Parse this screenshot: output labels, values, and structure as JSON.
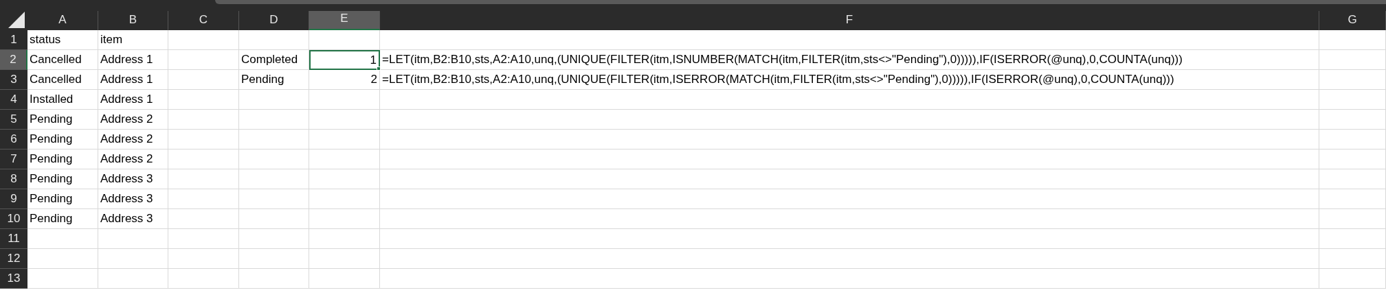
{
  "columns": [
    {
      "label": "A",
      "selected": false
    },
    {
      "label": "B",
      "selected": false
    },
    {
      "label": "C",
      "selected": false
    },
    {
      "label": "D",
      "selected": false
    },
    {
      "label": "E",
      "selected": true
    },
    {
      "label": "F",
      "selected": false
    },
    {
      "label": "G",
      "selected": false
    }
  ],
  "rows": [
    {
      "number": "1",
      "selected": false,
      "cells": {
        "A": "status",
        "B": "item"
      }
    },
    {
      "number": "2",
      "selected": true,
      "cells": {
        "A": "Cancelled",
        "B": "Address 1",
        "D": "Completed",
        "E": "1",
        "F": "=LET(itm,B2:B10,sts,A2:A10,unq,(UNIQUE(FILTER(itm,ISNUMBER(MATCH(itm,FILTER(itm,sts<>\"Pending\"),0))))),IF(ISERROR(@unq),0,COUNTA(unq)))"
      }
    },
    {
      "number": "3",
      "selected": false,
      "cells": {
        "A": "Cancelled",
        "B": "Address 1",
        "D": "Pending",
        "E": "2",
        "F": "=LET(itm,B2:B10,sts,A2:A10,unq,(UNIQUE(FILTER(itm,ISERROR(MATCH(itm,FILTER(itm,sts<>\"Pending\"),0))))),IF(ISERROR(@unq),0,COUNTA(unq)))"
      }
    },
    {
      "number": "4",
      "selected": false,
      "cells": {
        "A": "Installed",
        "B": "Address 1"
      }
    },
    {
      "number": "5",
      "selected": false,
      "cells": {
        "A": "Pending",
        "B": "Address 2"
      }
    },
    {
      "number": "6",
      "selected": false,
      "cells": {
        "A": "Pending",
        "B": "Address 2"
      }
    },
    {
      "number": "7",
      "selected": false,
      "cells": {
        "A": "Pending",
        "B": "Address 2"
      }
    },
    {
      "number": "8",
      "selected": false,
      "cells": {
        "A": "Pending",
        "B": "Address 3"
      }
    },
    {
      "number": "9",
      "selected": false,
      "cells": {
        "A": "Pending",
        "B": "Address 3"
      }
    },
    {
      "number": "10",
      "selected": false,
      "cells": {
        "A": "Pending",
        "B": "Address 3"
      }
    },
    {
      "number": "11",
      "selected": false,
      "cells": {}
    },
    {
      "number": "12",
      "selected": false,
      "cells": {}
    },
    {
      "number": "13",
      "selected": false,
      "cells": {}
    }
  ]
}
